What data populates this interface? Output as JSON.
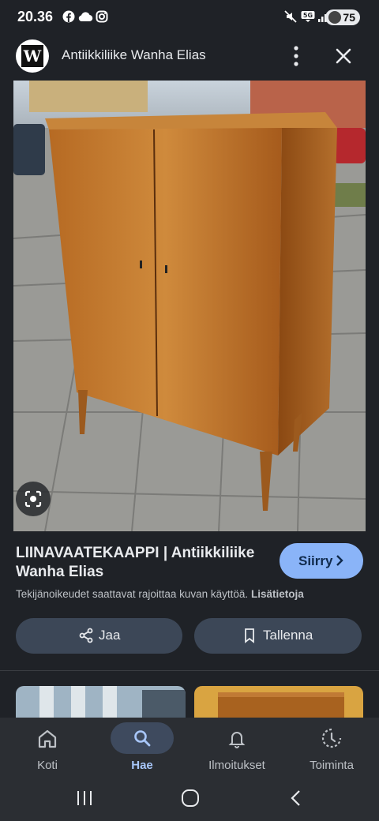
{
  "status_bar": {
    "time": "20.36",
    "battery": "75",
    "icons": [
      "facebook-icon",
      "cloud-icon",
      "instagram-icon",
      "mute-icon",
      "5g-icon",
      "signal-icon",
      "battery-icon"
    ]
  },
  "header": {
    "logo_letter": "W",
    "title": "Antiikkiliike Wanha Elias",
    "icons": [
      "more-vert-icon",
      "close-icon"
    ]
  },
  "result": {
    "title": "LIINAVAATEKAAPPI | Antiikkiliike Wanha Elias",
    "visit_label": "Siirry",
    "rights_text": "Tekijänoikeudet saattavat rajoittaa kuvan käyttöä.",
    "more_info_label": "Lisätietoja"
  },
  "actions": {
    "share_label": "Jaa",
    "save_label": "Tallenna"
  },
  "bottom_nav": [
    {
      "label": "Koti",
      "icon": "home-icon",
      "active": false
    },
    {
      "label": "Hae",
      "icon": "search-icon",
      "active": true
    },
    {
      "label": "Ilmoitukset",
      "icon": "bell-icon",
      "active": false
    },
    {
      "label": "Toiminta",
      "icon": "activity-icon",
      "active": false
    }
  ],
  "colors": {
    "background": "#1f2227",
    "accent": "#8ab4f8",
    "button": "#3c4757",
    "nav_active_text": "#a8c7fa"
  }
}
